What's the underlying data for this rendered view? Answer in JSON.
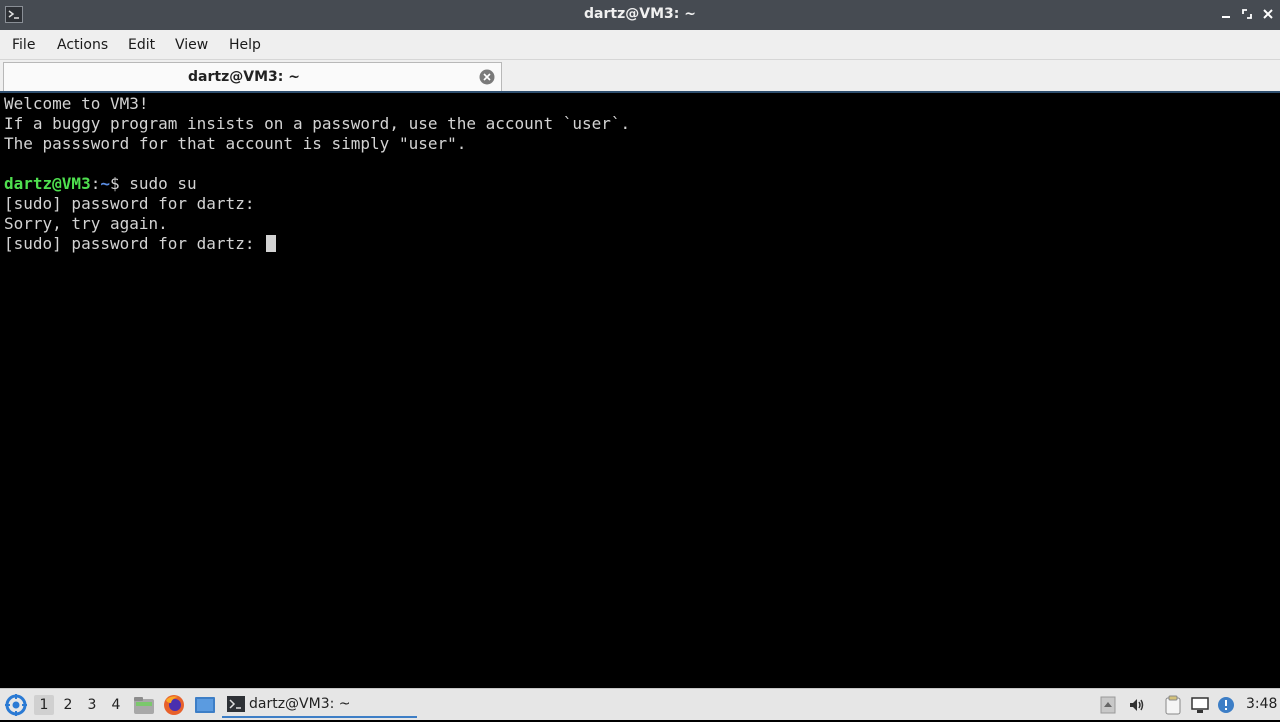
{
  "window": {
    "title": "dartz@VM3: ~",
    "controls": [
      "minimize-icon",
      "maximize-icon",
      "close-icon"
    ]
  },
  "menu": {
    "items": [
      {
        "label": "File"
      },
      {
        "label": "Actions"
      },
      {
        "label": "Edit"
      },
      {
        "label": "View"
      },
      {
        "label": "Help"
      }
    ]
  },
  "tab": {
    "label": "dartz@VM3: ~",
    "close_icon": "close-circle-icon"
  },
  "terminal": {
    "lines": [
      "Welcome to VM3!",
      "If a buggy program insists on a password, use the account `user`.",
      "The passsword for that account is simply \"user\".",
      "",
      "",
      "[sudo] password for dartz:",
      "Sorry, try again.",
      "[sudo] password for dartz: "
    ],
    "prompt": {
      "user_host": "dartz@VM3",
      "separator": ":",
      "path": "~",
      "symbol": "$ ",
      "command": "sudo su"
    },
    "colors": {
      "background": "#000000",
      "text": "#d3d3d3",
      "user_host": "#4fe04f",
      "path": "#5c8fe6"
    }
  },
  "taskbar": {
    "workspaces": [
      "1",
      "2",
      "3",
      "4"
    ],
    "active_workspace": "1",
    "launchers": [
      "file-manager-icon",
      "firefox-icon",
      "desktop-icon"
    ],
    "task": {
      "label": "dartz@VM3: ~",
      "icon": "terminal-icon"
    },
    "tray": [
      "tray-up-arrow-icon",
      "volume-icon",
      "clipboard-icon",
      "network-icon",
      "update-notification-icon"
    ],
    "clock": "3:48"
  }
}
